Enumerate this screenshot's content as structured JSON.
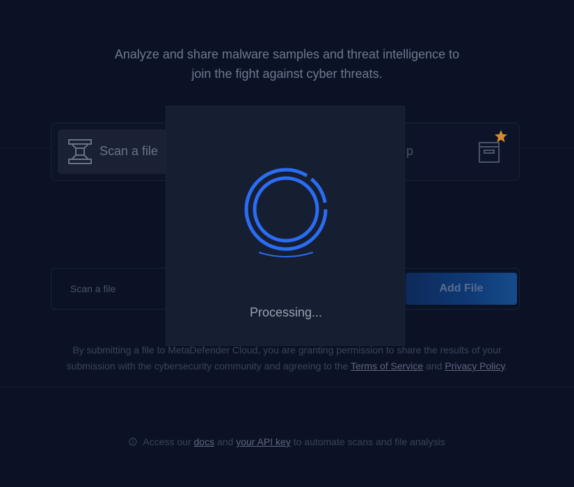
{
  "hero": {
    "line1": "Analyze and share malware samples and threat intelligence to",
    "line2": "join the fight against cyber threats."
  },
  "tabs": {
    "scan_file": "Scan a file",
    "partial_right": "p"
  },
  "upload": {
    "placeholder": "Scan a file",
    "add_button": "Add File"
  },
  "disclaimer": {
    "part1": "By submitting a file to MetaDefender Cloud, you are granting permission to share the results of your submission with the cybersecurity community and agreeing to the ",
    "terms_link": "Terms of Service",
    "and": " and ",
    "privacy_link": "Privacy Policy",
    "period": "."
  },
  "footer": {
    "prefix": "Access our ",
    "docs_link": "docs",
    "and": " and ",
    "api_link": "your API key",
    "suffix": " to automate scans and file analysis"
  },
  "modal": {
    "status": "Processing..."
  },
  "colors": {
    "background": "#0b1226",
    "modal": "#161e31",
    "spinner": "#2a6df4",
    "star": "#d98a2b"
  },
  "icons": {
    "scan": "scan-file-icon",
    "archive": "archive-icon",
    "star": "star-icon",
    "info": "info-icon",
    "spinner": "spinner-icon"
  }
}
